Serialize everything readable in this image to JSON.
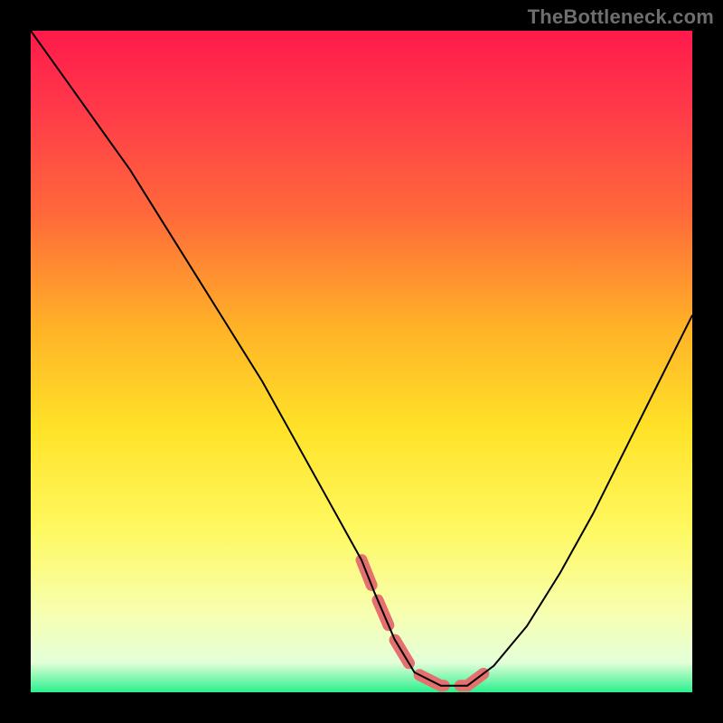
{
  "watermark": "TheBottleneck.com",
  "chart_data": {
    "type": "line",
    "title": "",
    "xlabel": "",
    "ylabel": "",
    "xlim": [
      0,
      100
    ],
    "ylim": [
      0,
      100
    ],
    "background_gradient": {
      "stops": [
        {
          "offset": 0.0,
          "color": "#ff1a4b"
        },
        {
          "offset": 0.12,
          "color": "#ff3a49"
        },
        {
          "offset": 0.28,
          "color": "#ff6a3a"
        },
        {
          "offset": 0.45,
          "color": "#ffb327"
        },
        {
          "offset": 0.6,
          "color": "#ffe228"
        },
        {
          "offset": 0.75,
          "color": "#fff85f"
        },
        {
          "offset": 0.88,
          "color": "#f7ffb0"
        },
        {
          "offset": 0.955,
          "color": "#e4ffd8"
        },
        {
          "offset": 1.0,
          "color": "#2bf08e"
        }
      ]
    },
    "series": [
      {
        "name": "bottleneck-curve",
        "color": "#000000",
        "stroke_width": 2,
        "x": [
          0,
          5,
          10,
          15,
          20,
          25,
          30,
          35,
          40,
          45,
          50,
          52,
          55,
          58,
          62,
          66,
          70,
          75,
          80,
          85,
          90,
          95,
          100
        ],
        "values": [
          100,
          93,
          86,
          79,
          71,
          63,
          55,
          47,
          38,
          29,
          20,
          15,
          8,
          3,
          1,
          1,
          4,
          10,
          18,
          27,
          37,
          47,
          57
        ]
      }
    ],
    "highlight": {
      "name": "optimal-zone",
      "color": "#e4706f",
      "stroke_width": 13,
      "x": [
        50,
        52,
        55,
        58,
        62,
        66,
        70
      ],
      "values": [
        20,
        15,
        8,
        3,
        1,
        1,
        4
      ],
      "dash": [
        30,
        18
      ]
    }
  }
}
